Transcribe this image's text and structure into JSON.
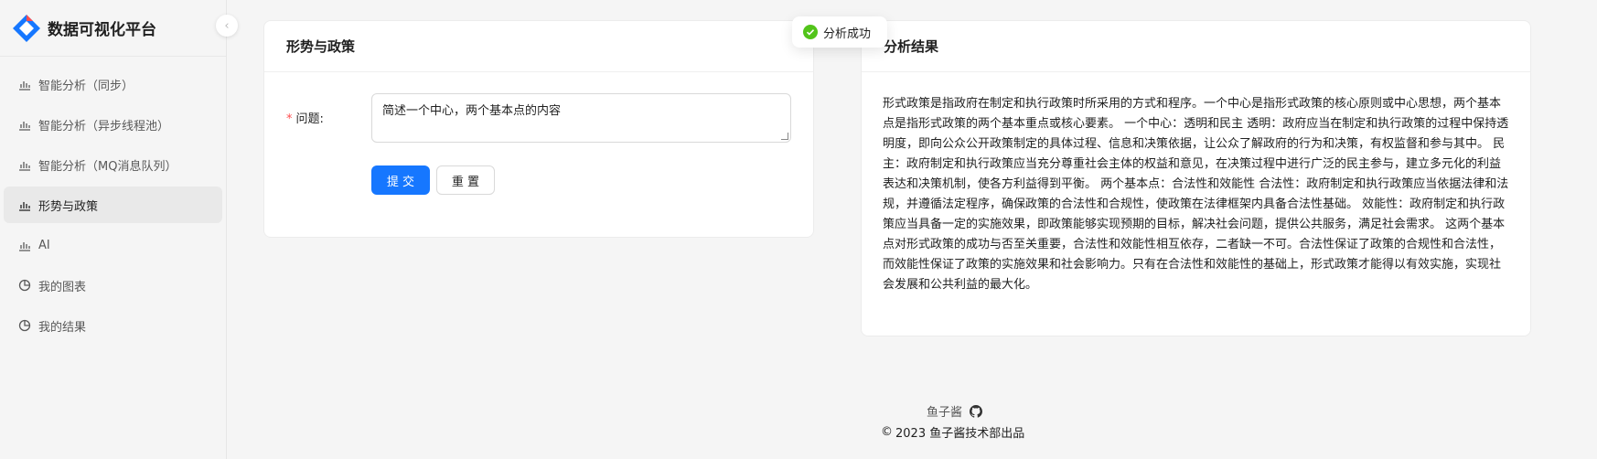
{
  "app": {
    "title": "数据可视化平台"
  },
  "sidebar": {
    "items": [
      {
        "label": "智能分析（同步）",
        "icon": "bar-chart-icon",
        "active": false
      },
      {
        "label": "智能分析（异步线程池）",
        "icon": "bar-chart-icon",
        "active": false
      },
      {
        "label": "智能分析（MQ消息队列）",
        "icon": "bar-chart-icon",
        "active": false
      },
      {
        "label": "形势与政策",
        "icon": "bar-chart-icon",
        "active": true
      },
      {
        "label": "AI",
        "icon": "bar-chart-icon",
        "active": false
      },
      {
        "label": "我的图表",
        "icon": "pie-chart-icon",
        "active": false
      },
      {
        "label": "我的结果",
        "icon": "pie-chart-icon",
        "active": false
      }
    ]
  },
  "toast": {
    "text": "分析成功",
    "icon": "check-circle-icon",
    "color": "#52c41a"
  },
  "left_card": {
    "title": "形势与政策",
    "question_label": "问题:",
    "question_value": "简述一个中心，两个基本点的内容",
    "submit_label": "提 交",
    "reset_label": "重 置"
  },
  "right_card": {
    "title": "分析结果",
    "result": "形式政策是指政府在制定和执行政策时所采用的方式和程序。一个中心是指形式政策的核心原则或中心思想，两个基本点是指形式政策的两个基本重点或核心要素。 一个中心：透明和民主 透明：政府应当在制定和执行政策的过程中保持透明度，即向公众公开政策制定的具体过程、信息和决策依据，让公众了解政府的行为和决策，有权监督和参与其中。 民主：政府制定和执行政策应当充分尊重社会主体的权益和意见，在决策过程中进行广泛的民主参与，建立多元化的利益表达和决策机制，使各方利益得到平衡。 两个基本点：合法性和效能性 合法性：政府制定和执行政策应当依据法律和法规，并遵循法定程序，确保政策的合法性和合规性，使政策在法律框架内具备合法性基础。 效能性：政府制定和执行政策应当具备一定的实施效果，即政策能够实现预期的目标，解决社会问题，提供公共服务，满足社会需求。 这两个基本点对形式政策的成功与否至关重要，合法性和效能性相互依存，二者缺一不可。合法性保证了政策的合规性和合法性，而效能性保证了政策的实施效果和社会影响力。只有在合法性和效能性的基础上，形式政策才能得以有效实施，实现社会发展和公共利益的最大化。"
  },
  "footer": {
    "author": "鱼子酱",
    "copyright": "2023 鱼子酱技术部出品"
  },
  "colors": {
    "primary": "#1677ff",
    "required": "#ff4d4f"
  }
}
